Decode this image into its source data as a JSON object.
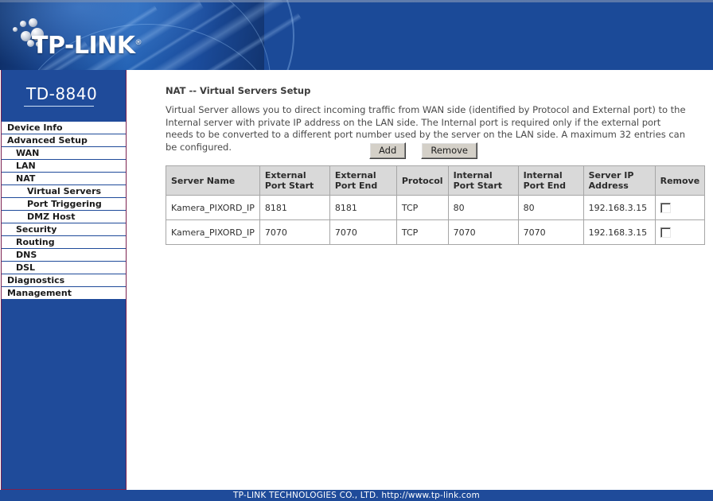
{
  "banner": {
    "brand": "TP-LINK",
    "trademark": "®",
    "model": "TD-8840"
  },
  "sidebar": {
    "items": [
      {
        "label": "Device Info",
        "level": 0
      },
      {
        "label": "Advanced Setup",
        "level": 0
      },
      {
        "label": "WAN",
        "level": 1
      },
      {
        "label": "LAN",
        "level": 1
      },
      {
        "label": "NAT",
        "level": 1
      },
      {
        "label": "Virtual Servers",
        "level": 2
      },
      {
        "label": "Port Triggering",
        "level": 2
      },
      {
        "label": "DMZ Host",
        "level": 2
      },
      {
        "label": "Security",
        "level": 1
      },
      {
        "label": "Routing",
        "level": 1
      },
      {
        "label": "DNS",
        "level": 1
      },
      {
        "label": "DSL",
        "level": 1
      },
      {
        "label": "Diagnostics",
        "level": 0
      },
      {
        "label": "Management",
        "level": 0
      }
    ]
  },
  "main": {
    "title": "NAT -- Virtual Servers Setup",
    "description": "Virtual Server allows you to direct incoming traffic from WAN side (identified by Protocol and External port) to the Internal server with private IP address on the LAN side. The Internal port is required only if the external port needs to be converted to a different port number used by the server on the LAN side. A maximum 32 entries can be configured.",
    "buttons": {
      "add": "Add",
      "remove": "Remove"
    },
    "table": {
      "columns": [
        "Server Name",
        "External Port Start",
        "External Port End",
        "Protocol",
        "Internal Port Start",
        "Internal Port End",
        "Server IP Address",
        "Remove"
      ],
      "rows": [
        {
          "server_name": "Kamera_PIXORD_IP",
          "external_port_start": "8181",
          "external_port_end": "8181",
          "protocol": "TCP",
          "internal_port_start": "80",
          "internal_port_end": "80",
          "server_ip_address": "192.168.3.15",
          "remove_checked": false
        },
        {
          "server_name": "Kamera_PIXORD_IP",
          "external_port_start": "7070",
          "external_port_end": "7070",
          "protocol": "TCP",
          "internal_port_start": "7070",
          "internal_port_end": "7070",
          "server_ip_address": "192.168.3.15",
          "remove_checked": false
        }
      ]
    }
  },
  "footer": {
    "text": "TP-LINK TECHNOLOGIES CO., LTD. http://www.tp-link.com"
  },
  "colors": {
    "brand_blue": "#1f4b9a",
    "banner_dark": "#0d2c63",
    "sidebar_border": "#7c2250",
    "table_header": "#d9d9d9",
    "button_face": "#d4d0c8"
  }
}
